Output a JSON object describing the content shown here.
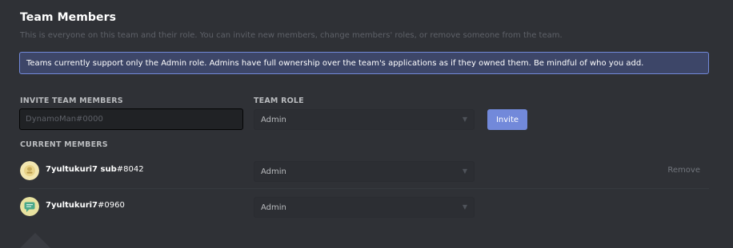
{
  "header": {
    "title": "Team Members",
    "description": "This is everyone on this team and their role. You can invite new members, change members' roles, or remove someone from the team."
  },
  "notice": {
    "text": "Teams currently support only the Admin role. Admins have full ownership over the team's applications as if they owned them. Be mindful of who you add."
  },
  "invite": {
    "section_label": "INVITE TEAM MEMBERS",
    "input_placeholder": "DynamoMan#0000",
    "input_value": "",
    "role_label": "TEAM ROLE",
    "role_value": "Admin",
    "button_label": "Invite"
  },
  "members": {
    "section_label": "CURRENT MEMBERS",
    "list": [
      {
        "username": "7yultukuri7 sub",
        "discriminator": "#8042",
        "role": "Admin",
        "remove_label": "Remove",
        "avatar_icon": "avatar-face-yellow"
      },
      {
        "username": "7yultukuri7",
        "discriminator": "#0960",
        "role": "Admin",
        "avatar_icon": "avatar-speech-bubble-green"
      }
    ]
  },
  "colors": {
    "background": "#2f3136",
    "accent": "#7289da",
    "notice_background": "#3d4668",
    "input_background": "#202225"
  }
}
